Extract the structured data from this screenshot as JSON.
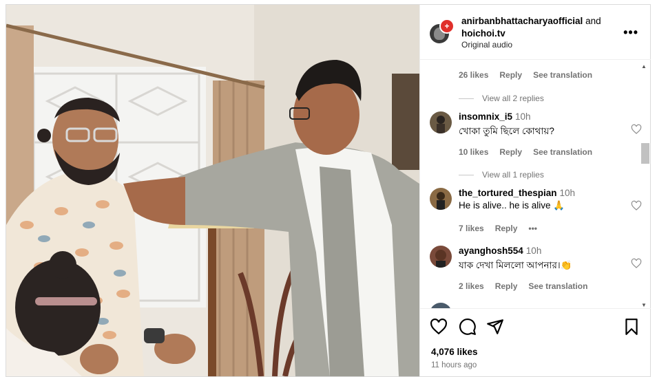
{
  "header": {
    "user1": "anirbanbhattacharyaofficial",
    "and": "and",
    "user2": "hoichoi.tv",
    "audio": "Original audio",
    "more": "•••"
  },
  "top_meta": {
    "likes": "26 likes",
    "reply": "Reply",
    "translate": "See translation"
  },
  "replies1": "View all 2 replies",
  "replies2": "View all 1 replies",
  "comments": [
    {
      "user": "insomnix_i5",
      "time": "10h",
      "text": "খোকা তুমি ছিলে কোথায়?",
      "likes": "10 likes",
      "reply": "Reply",
      "translate": "See translation"
    },
    {
      "user": "the_tortured_thespian",
      "time": "10h",
      "text": "He is alive.. he is alive 🙏",
      "likes": "7 likes",
      "reply": "Reply",
      "more": "•••"
    },
    {
      "user": "ayanghosh554",
      "time": "10h",
      "text": "যাক দেখা মিললো আপনার।👏",
      "likes": "2 likes",
      "reply": "Reply",
      "translate": "See translation"
    }
  ],
  "footer": {
    "likes": "4,076 likes",
    "time_ago": "11 hours ago"
  },
  "icons": [
    "heart-icon",
    "comment-icon",
    "share-icon",
    "save-icon",
    "more-icon"
  ],
  "colors": {
    "border": "#dbdbdb",
    "muted": "#737373",
    "live": "#e0302b"
  }
}
